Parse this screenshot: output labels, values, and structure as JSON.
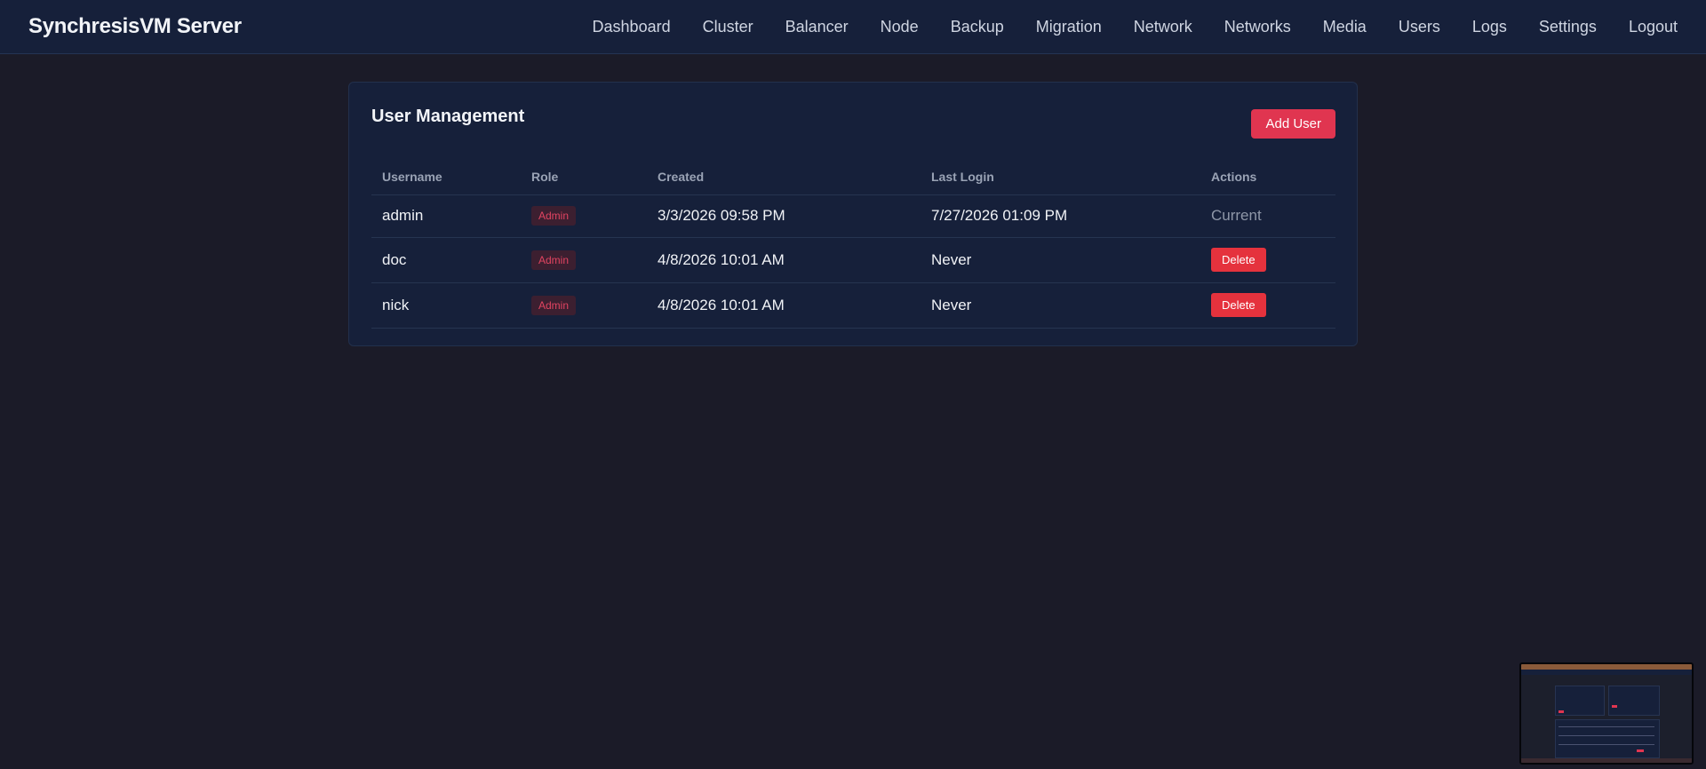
{
  "header": {
    "brand": "SynchresisVM Server",
    "nav": [
      "Dashboard",
      "Cluster",
      "Balancer",
      "Node",
      "Backup",
      "Migration",
      "Network",
      "Networks",
      "Media",
      "Users",
      "Logs",
      "Settings",
      "Logout"
    ]
  },
  "users_panel": {
    "title": "User Management",
    "add_button": "Add User",
    "columns": [
      "Username",
      "Role",
      "Created",
      "Last Login",
      "Actions"
    ],
    "rows": [
      {
        "username": "admin",
        "role": "Admin",
        "created": "3/3/2026 09:58 PM",
        "last_login": "7/27/2026 01:09 PM",
        "action": "Current"
      },
      {
        "username": "doc",
        "role": "Admin",
        "created": "4/8/2026 10:01 AM",
        "last_login": "Never",
        "action": "Delete"
      },
      {
        "username": "nick",
        "role": "Admin",
        "created": "4/8/2026 10:01 AM",
        "last_login": "Never",
        "action": "Delete"
      }
    ]
  },
  "colors": {
    "background": "#1b1b28",
    "panel": "#16203a",
    "accent": "#e03550",
    "danger": "#e5323d"
  }
}
